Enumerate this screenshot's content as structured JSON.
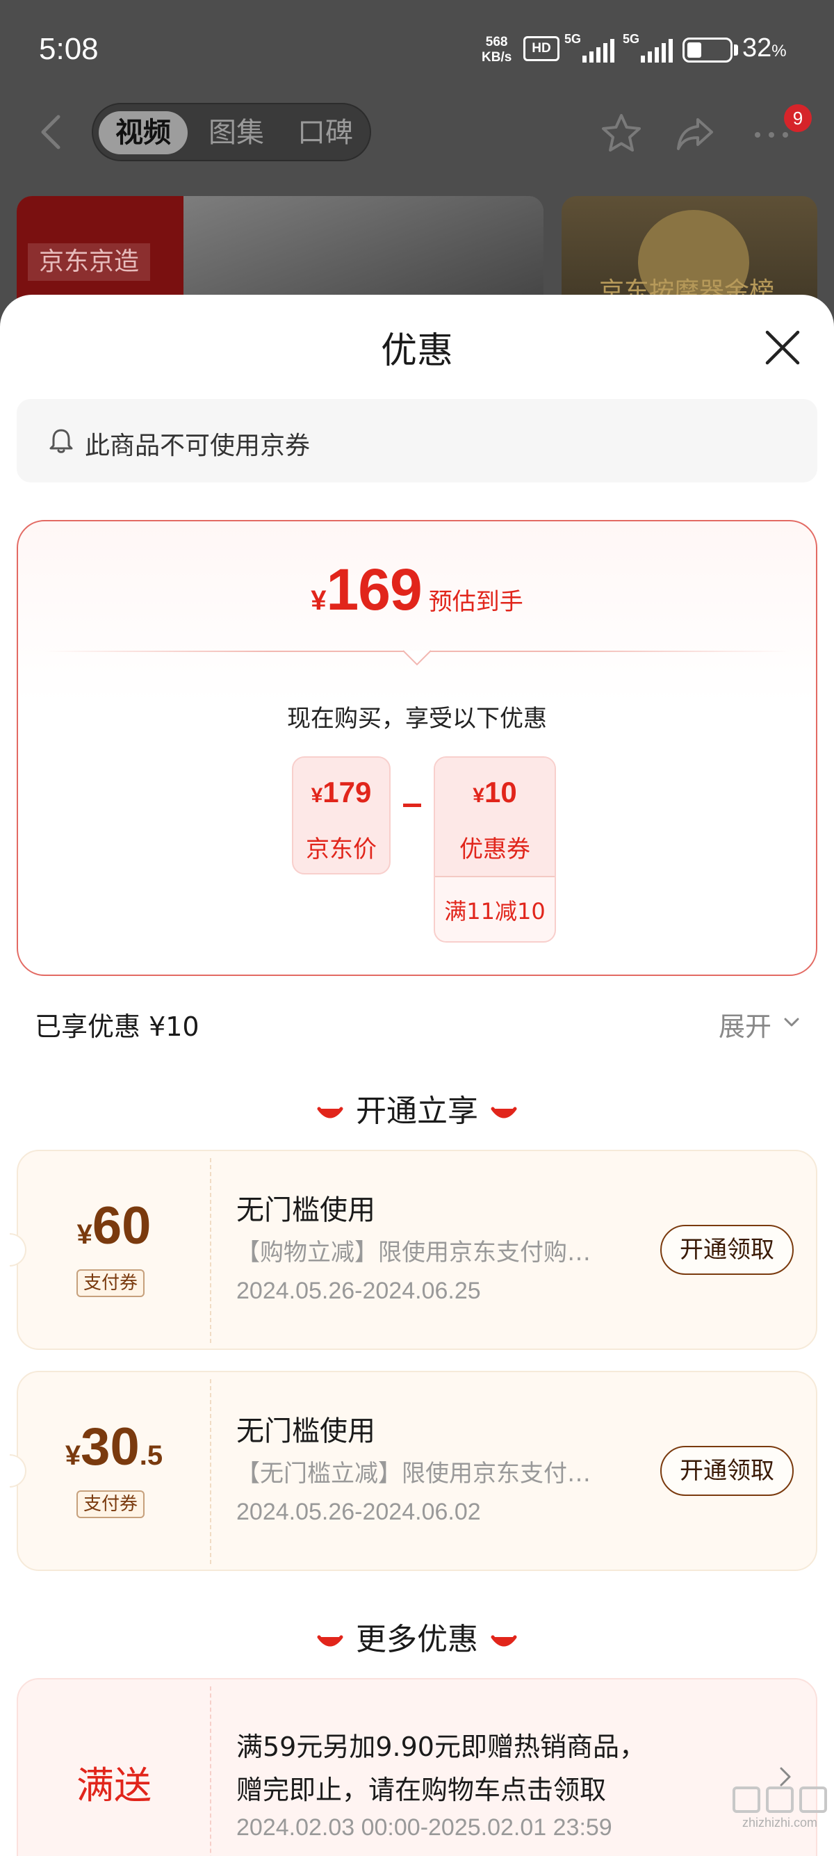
{
  "status_bar": {
    "time": "5:08",
    "net_speed_value": "568",
    "net_speed_unit": "KB/s",
    "hd_badge": "HD",
    "signal_1": "5G",
    "signal_2": "5G",
    "battery_percent": "32",
    "battery_unit": "%"
  },
  "nav": {
    "tabs": [
      "视频",
      "图集",
      "口碑"
    ],
    "active_tab": 0,
    "more_badge": "9"
  },
  "thumbnails": {
    "left_tag": "京东京造",
    "right_tag": "京东按摩器金榜"
  },
  "sheet": {
    "title": "优惠",
    "notice": "此商品不可使用京券"
  },
  "summary": {
    "currency": "¥",
    "final_price": "169",
    "final_label": "预估到手",
    "buy_text": "现在购买，享受以下优惠",
    "price_card": {
      "currency": "¥",
      "value": "179",
      "label": "京东价"
    },
    "coupon_card": {
      "currency": "¥",
      "value": "10",
      "label": "优惠券",
      "condition": "满11减10"
    }
  },
  "enjoyed": {
    "text": "已享优惠 ¥10",
    "expand_label": "展开"
  },
  "section_open": {
    "title": "开通立享"
  },
  "coupons": [
    {
      "currency": "¥",
      "amount": "60",
      "decimal": "",
      "type": "支付券",
      "title": "无门槛使用",
      "desc": "【购物立减】限使用京东支付购…",
      "date": "2024.05.26-2024.06.25",
      "button": "开通领取"
    },
    {
      "currency": "¥",
      "amount": "30",
      "decimal": ".5",
      "type": "支付券",
      "title": "无门槛使用",
      "desc": "【无门槛立减】限使用京东支付…",
      "date": "2024.05.26-2024.06.02",
      "button": "开通领取"
    }
  ],
  "section_more": {
    "title": "更多优惠"
  },
  "promo": {
    "tag": "满送",
    "line1": "满59元另加9.90元即赠热销商品，",
    "line2": "赠完即止，请在购物车点击领取",
    "date": "2024.02.03 00:00-2025.02.01 23:59"
  },
  "watermark": {
    "text": "zhizhizhi.com"
  },
  "colors": {
    "accent_red": "#e1251b",
    "coupon_brown": "#7a3a0e",
    "overlay_gray": "#4d4d4d"
  },
  "icons": [
    "back-arrow-icon",
    "star-icon",
    "share-icon",
    "more-icon",
    "close-icon",
    "bell-icon",
    "chevron-down-icon",
    "smile-icon",
    "chevron-right-icon"
  ]
}
